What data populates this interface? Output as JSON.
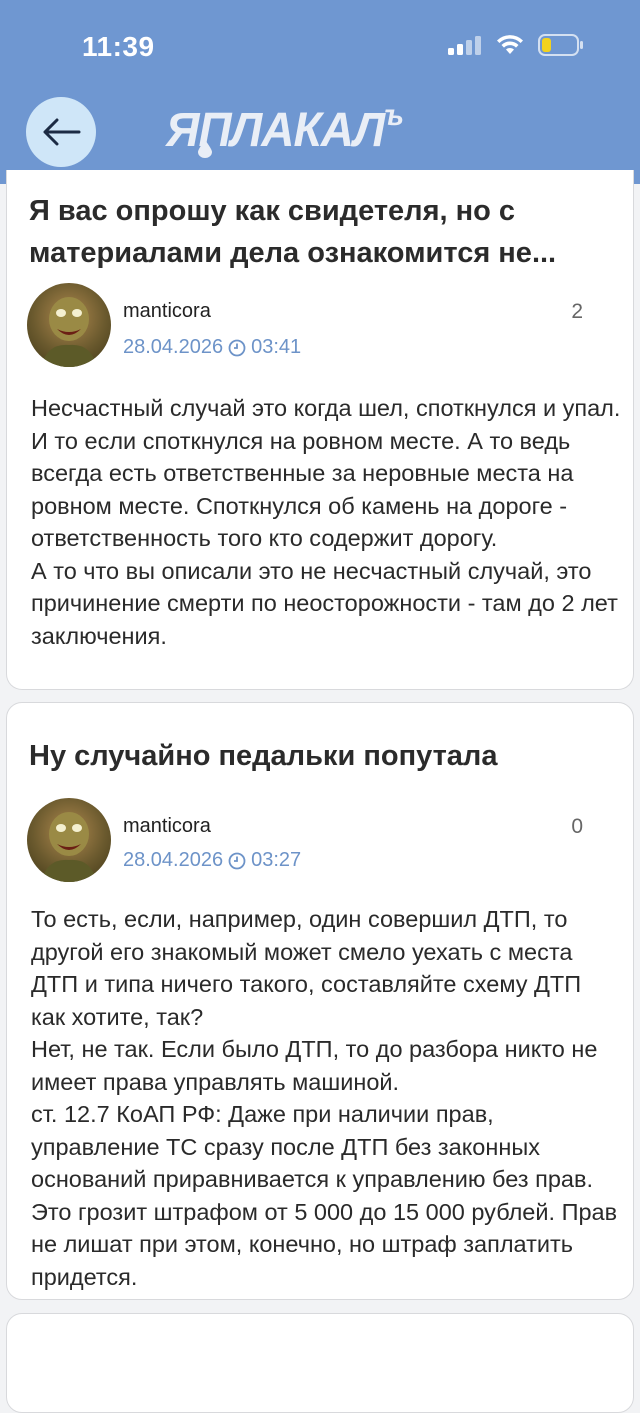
{
  "status": {
    "time": "11:39",
    "colors": {
      "header_bg": "#6f97d1",
      "battery_fill": "#f2d21f"
    }
  },
  "nav": {
    "logo_text": "ЯПЛАКАЛ",
    "logo_sup": "ъ"
  },
  "posts": [
    {
      "title": "Я вас опрошу как свидетеля, но с материалами дела ознакомится не...",
      "author": "manticora",
      "date": "28.04.2026",
      "time": "03:41",
      "score": "2",
      "body": "Несчастный случай это когда шел, споткнулся и упал. И то если споткнулся на ровном месте. А то ведь всегда есть ответственные за неровные места на ровном месте. Споткнулся об камень на дороге - ответственность того кто содержит дорогу.\nА то что вы описали это не несчастный случай, это причинение смерти по неосторожности - там до 2 лет заключения."
    },
    {
      "title": "Ну случайно педальки попутала",
      "author": "manticora",
      "date": "28.04.2026",
      "time": "03:27",
      "score": "0",
      "body": "То есть, если, например, один совершил ДТП, то другой его знакомый может смело уехать с места ДТП и типа ничего такого, составляйте схему ДТП как хотите, так?\nНет, не так. Если было ДТП, то до разбора никто не имеет права управлять машиной.\nст. 12.7 КоАП РФ: Даже при наличии прав, управление ТС сразу после ДТП без законных оснований приравнивается к управлению без прав. Это грозит штрафом от 5 000 до 15 000 рублей. Прав не лишат при этом, конечно, но штраф заплатить придется."
    }
  ]
}
